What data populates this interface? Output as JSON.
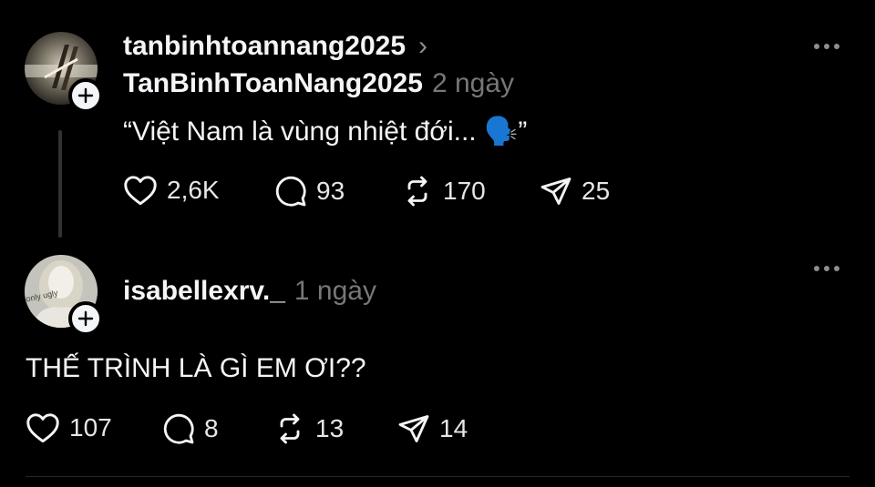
{
  "post": {
    "username": "tanbinhtoannang2025",
    "chevron": "›",
    "display_name": "TanBinhToanNang2025",
    "time": "2 ngày",
    "text": "“Việt Nam là vùng nhiệt đới... 🗣️”",
    "likes": "2,6K",
    "comments": "93",
    "reposts": "170",
    "shares": "25"
  },
  "reply": {
    "username": "isabellexrv._",
    "time": "1 ngày",
    "text": "THẾ TRÌNH LÀ GÌ EM ƠI??",
    "likes": "107",
    "comments": "8",
    "reposts": "13",
    "shares": "14"
  },
  "icons": {
    "like": "heart-icon",
    "comment": "comment-icon",
    "repost": "repost-icon",
    "share": "send-icon",
    "more": "more-icon",
    "follow": "plus-icon"
  },
  "colors": {
    "background": "#000000",
    "text": "#f3f5f7",
    "muted": "#777777",
    "thread_line": "#323232"
  }
}
